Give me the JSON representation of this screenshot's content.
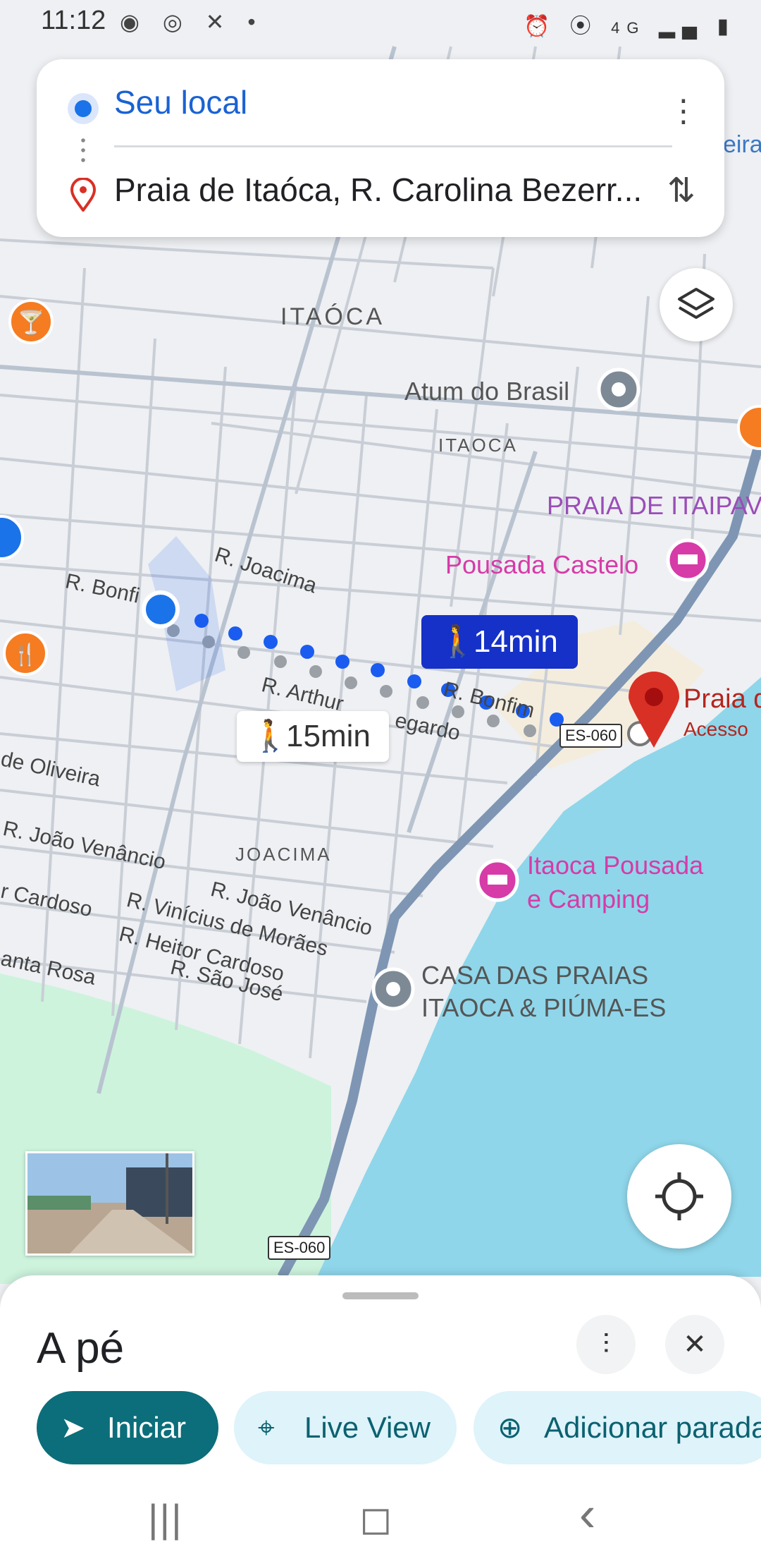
{
  "status_bar": {
    "time": "11:12",
    "left_icons": [
      "radio-icon",
      "chrome-icon",
      "x-icon",
      "dot-icon"
    ],
    "right_icons": [
      "alarm-icon",
      "location-icon",
      "4g-icon",
      "signal-icon",
      "battery-icon"
    ],
    "network": "4G"
  },
  "route_card": {
    "origin": "Seu local",
    "destination": "Praia de Itaóca, R. Carolina Bezerr..."
  },
  "map": {
    "neighborhood_labels": [
      "ITAÓCA",
      "ITAOCA",
      "JOACIMA",
      "PRAIA DE ITAIPAV"
    ],
    "street_labels": {
      "bonfim_left": "R. Bonfi",
      "joacima": "R. Joacima",
      "arthur": "R. Arthur",
      "egardo": "egardo",
      "bonfim_right": "R. Bonfim",
      "oliveira": "de Oliveira",
      "joao_venancio_1": "R. João Venâncio",
      "joao_venancio_2": "R. João Venâncio",
      "cardoso": "r Cardoso",
      "vinicius": "R. Vinícius de Morães",
      "heitor": "R. Heitor Cardoso",
      "santa_rosa": "anta Rosa",
      "sao_jose": "R. São José",
      "eira": "eira"
    },
    "highway_shields": [
      "ES-060",
      "ES-060"
    ],
    "places": {
      "atum": "Atum do Brasil",
      "castelo": "Pousada Castelo",
      "itaoca_pousada_line1": "Itaoca Pousada",
      "itaoca_pousada_line2": "e Camping",
      "casa_line1": "CASA DAS PRAIAS",
      "casa_line2": "ITAOCA & PIÚMA-ES",
      "praia": "Praia d",
      "praia_sub": "Acesso"
    },
    "route_times": {
      "selected": "14min",
      "alternative": "15min"
    },
    "colors": {
      "route_primary": "#1a5cf0",
      "route_alternative": "#9aa0a6",
      "water": "#8fd6ea",
      "park": "#cdf3dd",
      "road_main": "#7e96b3",
      "destination_pin": "#d93025",
      "hotel_pink": "#d63ba8",
      "food_orange": "#f57c20"
    }
  },
  "bottom_sheet": {
    "title": "A pé",
    "buttons": {
      "start": "Iniciar",
      "live_view": "Live View",
      "add_stop": "Adicionar parada"
    }
  },
  "nav_bar": {
    "recent": "|||",
    "home": "◻",
    "back": "‹"
  }
}
